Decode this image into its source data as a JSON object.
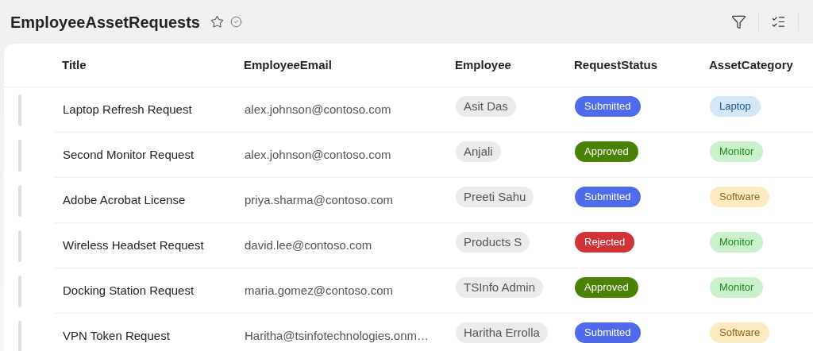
{
  "title": "EmployeeAssetRequests",
  "table": {
    "columns": [
      "Title",
      "EmployeeEmail",
      "Employee",
      "RequestStatus",
      "AssetCategory"
    ],
    "rows": [
      {
        "title": "Laptop Refresh Request",
        "email": "alex.johnson@contoso.com",
        "employee": "Asit Das",
        "status": {
          "label": "Submitted",
          "color": "#4f6bed"
        },
        "category": {
          "label": "Laptop",
          "color": "#d4e7f8"
        }
      },
      {
        "title": "Second Monitor Request",
        "email": "alex.johnson@contoso.com",
        "employee": "Anjali",
        "status": {
          "label": "Approved",
          "color": "#498205"
        },
        "category": {
          "label": "Monitor",
          "color": "#cbf0cc"
        }
      },
      {
        "title": "Adobe Acrobat License",
        "email": "priya.sharma@contoso.com",
        "employee": "Preeti Sahu",
        "status": {
          "label": "Submitted",
          "color": "#4f6bed"
        },
        "category": {
          "label": "Software",
          "color": "#fdeac0"
        }
      },
      {
        "title": "Wireless Headset Request",
        "email": "david.lee@contoso.com",
        "employee": "Products S",
        "status": {
          "label": "Rejected",
          "color": "#d13438"
        },
        "category": {
          "label": "Monitor",
          "color": "#cbf0cc"
        }
      },
      {
        "title": "Docking Station Request",
        "email": "maria.gomez@contoso.com",
        "employee": "TSInfo Admin",
        "status": {
          "label": "Approved",
          "color": "#498205"
        },
        "category": {
          "label": "Monitor",
          "color": "#cbf0cc"
        }
      },
      {
        "title": "VPN Token Request",
        "email": "Haritha@tsinfotechnologies.onm…",
        "employee": "Haritha Errolla",
        "status": {
          "label": "Submitted",
          "color": "#4f6bed"
        },
        "category": {
          "label": "Software",
          "color": "#fdeac0"
        }
      }
    ]
  }
}
